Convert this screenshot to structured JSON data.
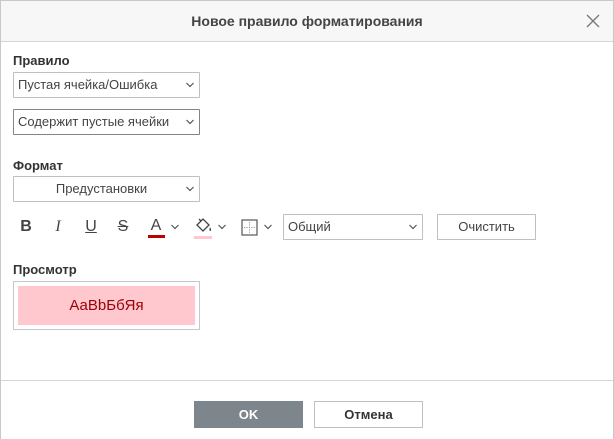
{
  "dialog": {
    "title": "Новое правило форматирования",
    "close_icon": "close-icon"
  },
  "rule": {
    "label": "Правило",
    "type_value": "Пустая ячейка/Ошибка",
    "condition_value": "Содержит пустые ячейки"
  },
  "format": {
    "label": "Формат",
    "preset_value": "Предустановки",
    "bold_glyph": "B",
    "italic_glyph": "I",
    "underline_glyph": "U",
    "strike_glyph": "S",
    "font_color_glyph": "A",
    "font_color": "#c00000",
    "fill_color": "#ffc7ce",
    "number_format_value": "Общий",
    "clear_label": "Очистить"
  },
  "preview": {
    "label": "Просмотр",
    "sample_text": "АаBbБбЯя",
    "text_color": "#9c0006",
    "bg_color": "#ffc7ce"
  },
  "footer": {
    "ok_label": "OK",
    "cancel_label": "Отмена"
  }
}
